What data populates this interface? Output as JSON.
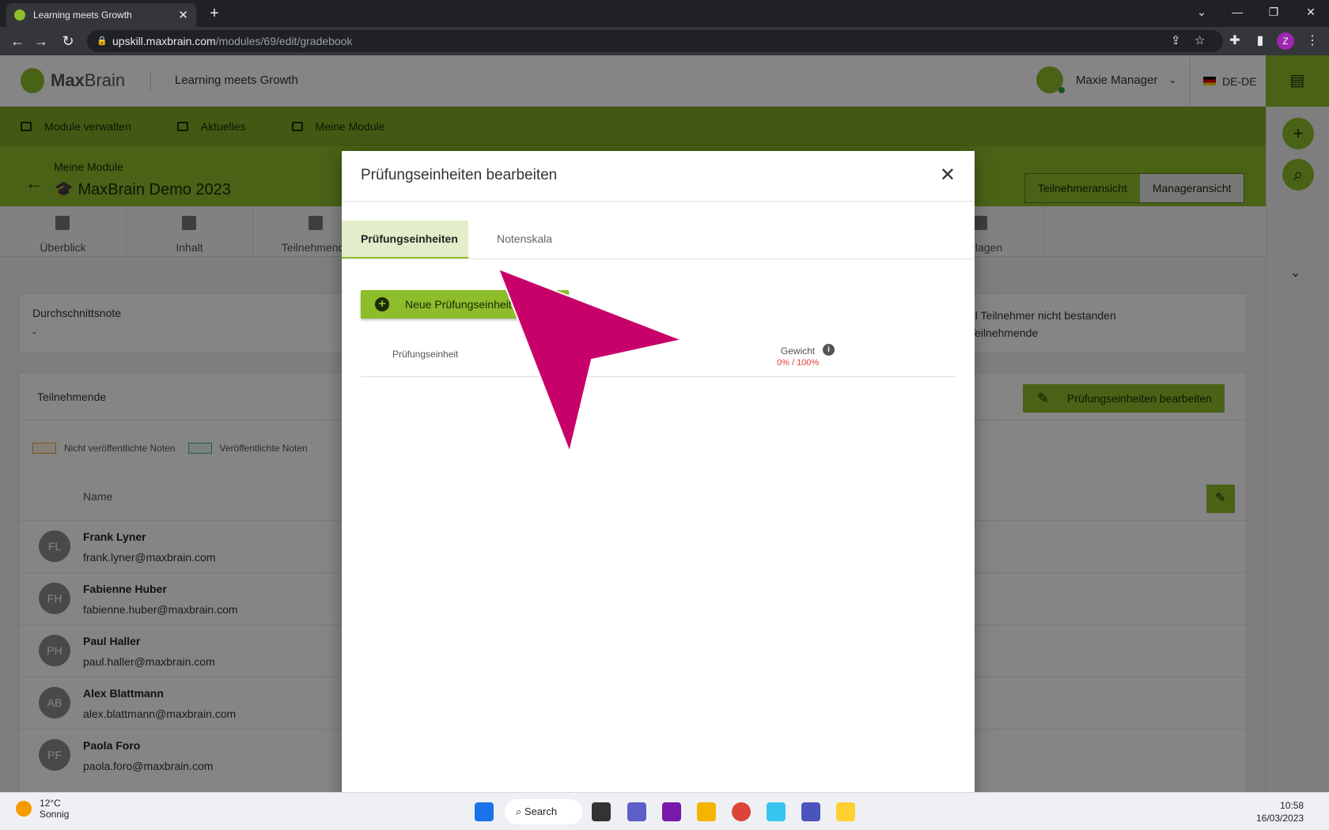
{
  "browser": {
    "tab_title": "Learning meets Growth",
    "url_host": "upskill.maxbrain.com",
    "url_path": "/modules/69/edit/gradebook",
    "profile_initial": "Z"
  },
  "app": {
    "brand_bold": "Max",
    "brand_light": "Brain",
    "tagline": "Learning meets Growth",
    "user_name": "Maxie Manager",
    "language": "DE-DE",
    "nav": [
      "Module verwalten",
      "Aktuelles",
      "Meine Module"
    ],
    "breadcrumb": "Meine Module",
    "module_title": "MaxBrain Demo 2023",
    "view_participant": "Teilnehmeransicht",
    "view_manager": "Manageransicht",
    "subtabs": [
      "Überblick",
      "Inhalt",
      "Teilnehmende",
      "Vorlagen"
    ],
    "stat_avg_label": "Durchschnittsnote",
    "stat_avg_value": "-",
    "stat_failed_line1": "hl Teilnehmer nicht bestanden",
    "stat_failed_line2": "Teilnehmende",
    "panel_title": "Teilnehmende",
    "edit_units_button": "Prüfungseinheiten bearbeiten",
    "legend_unpublished": "Nicht veröffentlichte Noten",
    "legend_published": "Veröffentlichte Noten",
    "name_header": "Name",
    "participants": [
      {
        "initials": "FL",
        "name": "Frank Lyner",
        "email": "frank.lyner@maxbrain.com"
      },
      {
        "initials": "FH",
        "name": "Fabienne Huber",
        "email": "fabienne.huber@maxbrain.com"
      },
      {
        "initials": "PH",
        "name": "Paul Haller",
        "email": "paul.haller@maxbrain.com"
      },
      {
        "initials": "AB",
        "name": "Alex Blattmann",
        "email": "alex.blattmann@maxbrain.com"
      },
      {
        "initials": "PF",
        "name": "Paola Foro",
        "email": "paola.foro@maxbrain.com"
      }
    ]
  },
  "modal": {
    "title": "Prüfungseinheiten bearbeiten",
    "tab_units": "Prüfungseinheiten",
    "tab_scale": "Notenskala",
    "new_button": "Neue Prüfungseinheit erstellen",
    "col_unit": "Prüfungseinheit",
    "col_weight": "Gewicht",
    "weight_total": "0% / 100%"
  },
  "taskbar": {
    "temperature": "12°C",
    "weather": "Sonnig",
    "search": "Search",
    "time": "10:58",
    "date": "16/03/2023"
  },
  "colors": {
    "brand_green": "#8dbd2b",
    "cursor_magenta": "#c8006a",
    "weight_red": "#e53935"
  }
}
